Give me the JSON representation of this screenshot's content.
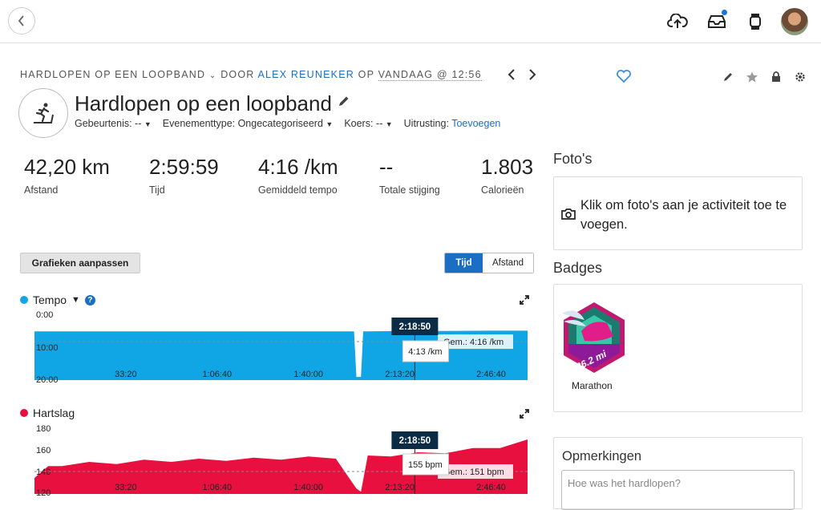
{
  "header": {
    "upload_icon": "cloud-upload-icon",
    "inbox_icon": "inbox-icon",
    "device_icon": "watch-icon",
    "accent": "#1976d2"
  },
  "breadcrumb": {
    "type": "HARDLOPEN OP EEN LOOPBAND",
    "by": "DOOR",
    "author": "ALEX REUNEKER",
    "on": "OP",
    "date": "VANDAAG @ 12:56"
  },
  "activity": {
    "title": "Hardlopen op een loopband",
    "meta": {
      "event_label": "Gebeurtenis: --",
      "event_type_label": "Evenementtype: Ongecategoriseerd",
      "course_label": "Koers: --",
      "gear_label": "Uitrusting:",
      "gear_link": "Toevoegen"
    }
  },
  "stats": [
    {
      "value": "42,20 km",
      "label": "Afstand"
    },
    {
      "value": "2:59:59",
      "label": "Tijd"
    },
    {
      "value": "4:16 /km",
      "label": "Gemiddeld tempo"
    },
    {
      "value": "--",
      "label": "Totale stijging"
    },
    {
      "value": "1.803",
      "label": "Calorieën"
    }
  ],
  "controls": {
    "customize_button": "Grafieken aanpassen",
    "toggle_time": "Tijd",
    "toggle_distance": "Afstand"
  },
  "chart_data": [
    {
      "type": "area",
      "title": "Tempo",
      "color": "#10a6e6",
      "y_ticks": [
        "0:00",
        "10:00",
        "20:00"
      ],
      "ylim_min_per_km": [
        0,
        20
      ],
      "y_inverted": true,
      "x_ticks": [
        "33:20",
        "1:06:40",
        "1:40:00",
        "2:13:20",
        "2:46:40"
      ],
      "xlim_seconds": [
        0,
        10799
      ],
      "avg_label": "Gem.: 4:16 /km",
      "cursor_time": "2:18:50",
      "cursor_value": "4:13 /km",
      "series": [
        {
          "x_seconds": [
            0,
            1000,
            2000,
            3000,
            4000,
            5000,
            6000,
            7000,
            7050,
            7150,
            7200,
            8000,
            9000,
            10000,
            10799
          ],
          "pace_min_per_km": [
            4.2,
            4.2,
            4.2,
            4.2,
            4.2,
            4.2,
            4.2,
            4.2,
            19,
            19,
            4.2,
            4.1,
            4.1,
            4.0,
            4.0
          ]
        }
      ]
    },
    {
      "type": "area",
      "title": "Hartslag",
      "color": "#e8103f",
      "y_ticks": [
        "120",
        "140",
        "160",
        "180"
      ],
      "ylim": [
        120,
        180
      ],
      "x_ticks": [
        "33:20",
        "1:06:40",
        "1:40:00",
        "2:13:20",
        "2:46:40"
      ],
      "xlim_seconds": [
        0,
        10799
      ],
      "avg_label": "Gem.: 151 bpm",
      "cursor_time": "2:18:50",
      "cursor_value": "155 bpm",
      "series": [
        {
          "x_seconds": [
            0,
            300,
            600,
            1200,
            1800,
            2400,
            3000,
            3600,
            4200,
            4800,
            5400,
            6000,
            6600,
            7050,
            7150,
            7300,
            7800,
            8400,
            9000,
            9600,
            10200,
            10799
          ],
          "bpm": [
            135,
            143,
            146,
            147,
            148,
            149,
            150,
            150,
            151,
            151,
            152,
            152,
            153,
            122,
            122,
            153,
            155,
            156,
            158,
            160,
            163,
            168
          ]
        }
      ]
    }
  ],
  "sidebar": {
    "photos_title": "Foto's",
    "photos_text": "Klik om foto's aan je activiteit toe te voegen.",
    "badges_title": "Badges",
    "badge_text": "26.2 mi",
    "badge_label": "Marathon",
    "comments_title": "Opmerkingen",
    "comments_placeholder": "Hoe was het hardlopen?"
  }
}
